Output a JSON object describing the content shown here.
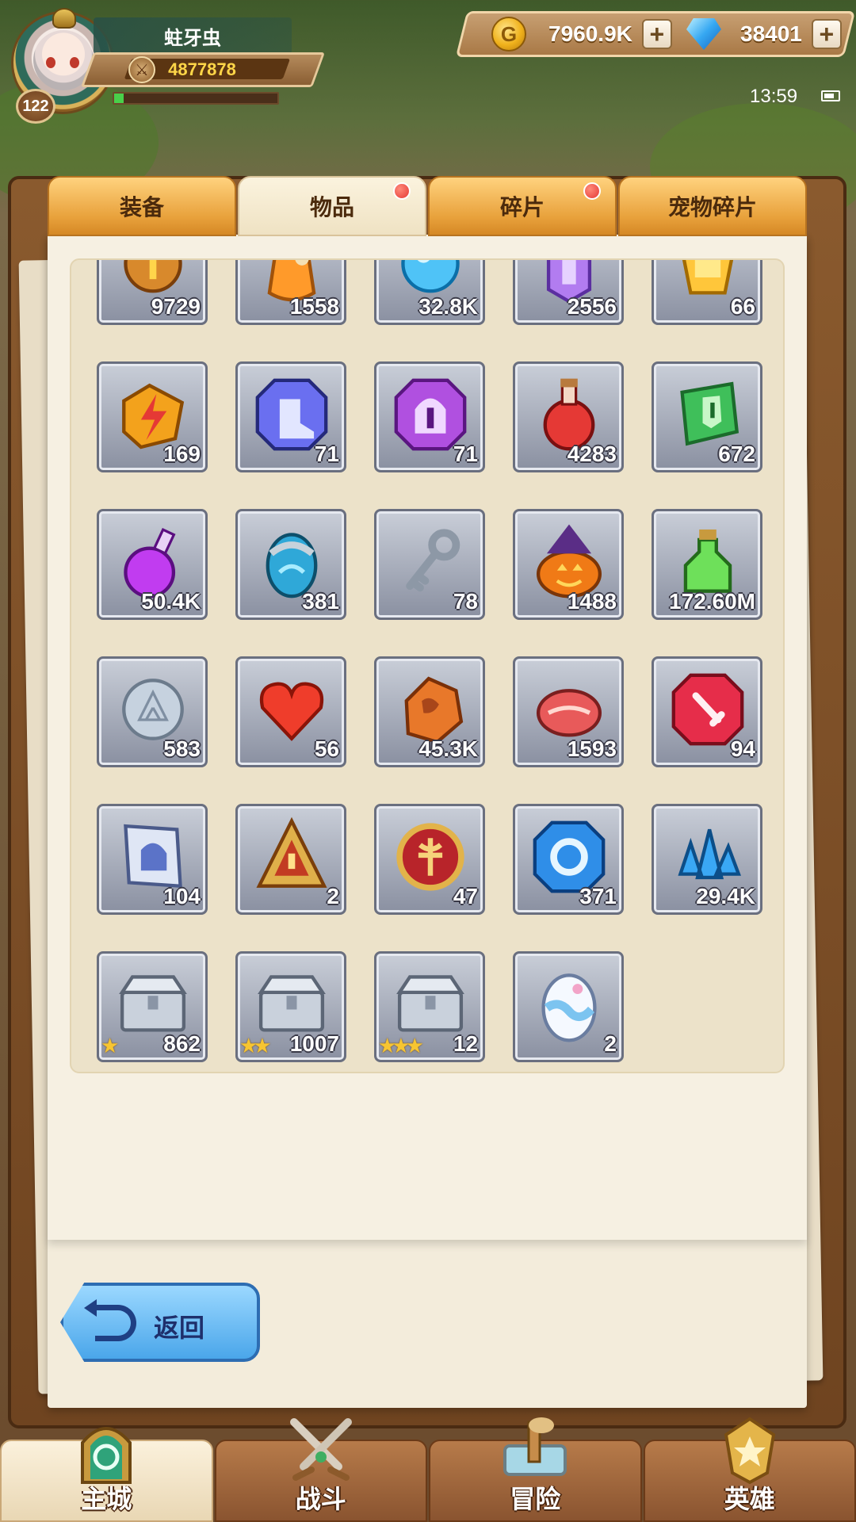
{
  "player": {
    "name": "蛀牙虫",
    "level": "122",
    "power": "4877878",
    "exp_fraction": 0.06
  },
  "currency": {
    "gold": "7960.9K",
    "diamonds": "38401",
    "gold_icon": "coin-icon",
    "diamond_icon": "diamond-icon"
  },
  "status": {
    "time": "13:59"
  },
  "tabs": [
    {
      "label": "装备",
      "badge": false
    },
    {
      "label": "物品",
      "badge": true,
      "active": true
    },
    {
      "label": "碎片",
      "badge": true
    },
    {
      "label": "宠物碎片",
      "badge": false
    }
  ],
  "items": [
    {
      "icon": "gold-token-icon",
      "count": "9729"
    },
    {
      "icon": "orange-pouch-icon",
      "count": "1558"
    },
    {
      "icon": "blue-orb-icon",
      "count": "32.8K"
    },
    {
      "icon": "purple-crystal-icon",
      "count": "2556"
    },
    {
      "icon": "gold-gem-icon",
      "count": "66"
    },
    {
      "icon": "lightning-rune-icon",
      "count": "169"
    },
    {
      "icon": "blue-boot-gem-icon",
      "count": "71"
    },
    {
      "icon": "purple-helmet-gem-icon",
      "count": "71"
    },
    {
      "icon": "red-potion-icon",
      "count": "4283"
    },
    {
      "icon": "green-scroll-icon",
      "count": "672"
    },
    {
      "icon": "purple-potion-icon",
      "count": "50.4K"
    },
    {
      "icon": "blue-egg-icon",
      "count": "381"
    },
    {
      "icon": "silver-key-icon",
      "count": "78"
    },
    {
      "icon": "pumpkin-icon",
      "count": "1488"
    },
    {
      "icon": "green-potion-icon",
      "count": "172.60M"
    },
    {
      "icon": "silver-coin-icon",
      "count": "583"
    },
    {
      "icon": "heart-icon",
      "count": "56"
    },
    {
      "icon": "ore-stone-icon",
      "count": "45.3K"
    },
    {
      "icon": "meat-icon",
      "count": "1593"
    },
    {
      "icon": "red-sword-gem-icon",
      "count": "94"
    },
    {
      "icon": "helmet-scroll-icon",
      "count": "104"
    },
    {
      "icon": "rank-badge-icon",
      "count": "2"
    },
    {
      "icon": "red-emblem-icon",
      "count": "47"
    },
    {
      "icon": "blue-ring-gem-icon",
      "count": "371"
    },
    {
      "icon": "blue-crystal-cluster-icon",
      "count": "29.4K"
    },
    {
      "icon": "silver-chest-icon",
      "count": "862",
      "stars": 1
    },
    {
      "icon": "silver-chest-icon",
      "count": "1007",
      "stars": 2
    },
    {
      "icon": "silver-chest-icon",
      "count": "12",
      "stars": 3
    },
    {
      "icon": "pastel-egg-icon",
      "count": "2"
    }
  ],
  "back_button": {
    "label": "返回"
  },
  "bottom_nav": [
    {
      "label": "主城",
      "icon": "portal-icon",
      "active": true
    },
    {
      "label": "战斗",
      "icon": "crossed-swords-icon"
    },
    {
      "label": "冒险",
      "icon": "map-icon"
    },
    {
      "label": "英雄",
      "icon": "hero-crest-icon"
    }
  ],
  "colors": {
    "tab_orange": "#e8a13b",
    "tab_active": "#f6eddb",
    "badge_red": "#e53935",
    "gold_text": "#ffd648",
    "back_blue": "#4aa6ea"
  }
}
